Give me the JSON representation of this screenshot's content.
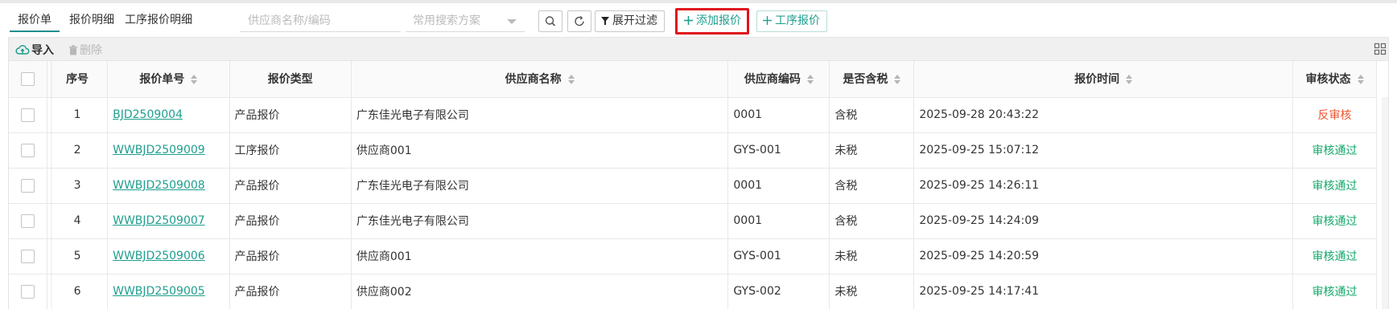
{
  "tabs": [
    {
      "label": "报价单",
      "active": true
    },
    {
      "label": "报价明细",
      "active": false
    },
    {
      "label": "工序报价明细",
      "active": false
    }
  ],
  "search": {
    "placeholder": "供应商名称/编码"
  },
  "scheme_select": {
    "placeholder": "常用搜索方案"
  },
  "buttons": {
    "search_icon": "search-icon",
    "refresh_icon": "refresh-icon",
    "filter_label": "展开过滤",
    "add_quote_label": "添加报价",
    "process_quote_label": "工序报价"
  },
  "subbar": {
    "import_label": "导入",
    "delete_label": "删除"
  },
  "table": {
    "columns": [
      "序号",
      "报价单号",
      "报价类型",
      "供应商名称",
      "供应商编码",
      "是否含税",
      "报价时间",
      "审核状态"
    ],
    "rows": [
      {
        "seq": "1",
        "no": "BJD2509004",
        "type": "产品报价",
        "supplier": "广东佳光电子有限公司",
        "code": "0001",
        "tax": "含税",
        "time": "2025-09-28 20:43:22",
        "status": "反审核",
        "status_kind": "reverse"
      },
      {
        "seq": "2",
        "no": "WWBJD2509009",
        "type": "工序报价",
        "supplier": "供应商001",
        "code": "GYS-001",
        "tax": "未税",
        "time": "2025-09-25 15:07:12",
        "status": "审核通过",
        "status_kind": "pass"
      },
      {
        "seq": "3",
        "no": "WWBJD2509008",
        "type": "产品报价",
        "supplier": "广东佳光电子有限公司",
        "code": "0001",
        "tax": "含税",
        "time": "2025-09-25 14:26:11",
        "status": "审核通过",
        "status_kind": "pass"
      },
      {
        "seq": "4",
        "no": "WWBJD2509007",
        "type": "产品报价",
        "supplier": "广东佳光电子有限公司",
        "code": "0001",
        "tax": "含税",
        "time": "2025-09-25 14:24:09",
        "status": "审核通过",
        "status_kind": "pass"
      },
      {
        "seq": "5",
        "no": "WWBJD2509006",
        "type": "产品报价",
        "supplier": "供应商001",
        "code": "GYS-001",
        "tax": "未税",
        "time": "2025-09-25 14:20:59",
        "status": "审核通过",
        "status_kind": "pass"
      },
      {
        "seq": "6",
        "no": "WWBJD2509005",
        "type": "产品报价",
        "supplier": "供应商002",
        "code": "GYS-002",
        "tax": "未税",
        "time": "2025-09-25 14:17:41",
        "status": "审核通过",
        "status_kind": "pass"
      }
    ]
  },
  "colors": {
    "accent": "#1f9e8e",
    "highlight": "#e0141e",
    "pass": "#14a86b",
    "reverse": "#f0532e"
  }
}
